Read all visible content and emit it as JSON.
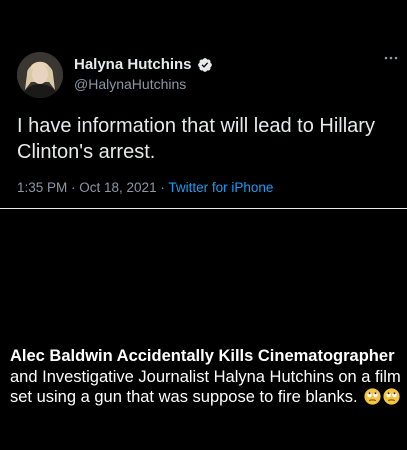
{
  "tweet": {
    "display_name": "Halyna Hutchins",
    "handle": "@HalynaHutchins",
    "text": "I have information that will lead to Hillary Clinton's arrest.",
    "timestamp": "1:35 PM · Oct 18, 2021 · ",
    "source": "Twitter for iPhone",
    "verified": true
  },
  "caption": {
    "bold": "Alec Baldwin Accidentally Kills Cinematographer",
    "rest": " and Investigative Journalist Halyna Hutchins on a film set using a gun that was suppose to fire blanks.",
    "emojis": [
      "eye-roll-emoji",
      "eye-roll-emoji"
    ]
  },
  "colors": {
    "background": "#000000",
    "text": "#e7e9ea",
    "muted": "#8b98a5",
    "link": "#1d9bf0",
    "verified": "#1d9bf0"
  }
}
